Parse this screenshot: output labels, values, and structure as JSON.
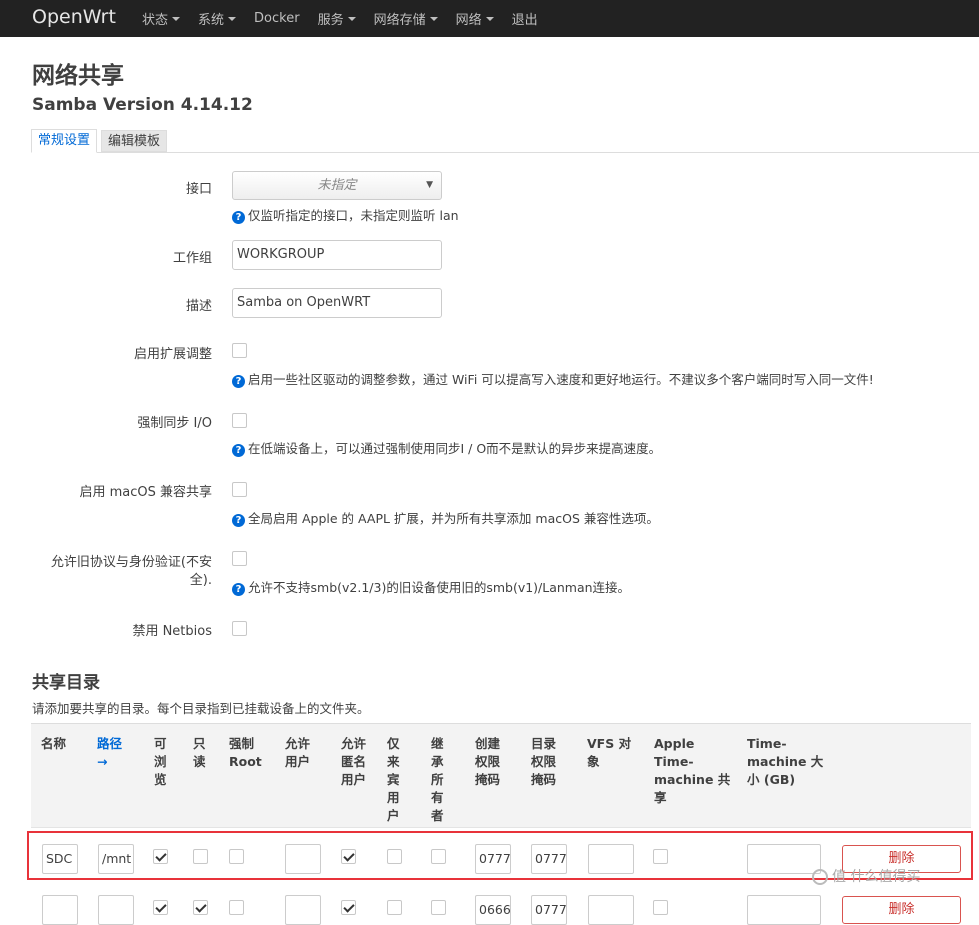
{
  "brand": "OpenWrt",
  "nav": [
    "状态",
    "系统",
    "Docker",
    "服务",
    "网络存储",
    "网络",
    "退出"
  ],
  "page_title": "网络共享",
  "version": "Samba Version 4.14.12",
  "tabs": [
    "常规设置",
    "编辑模板"
  ],
  "fields": {
    "interface_label": "接口",
    "interface_value": "未指定",
    "interface_help": "仅监听指定的接口，未指定则监听 lan",
    "workgroup_label": "工作组",
    "workgroup_value": "WORKGROUP",
    "description_label": "描述",
    "description_value": "Samba on OpenWRT",
    "ext_tuning_label": "启用扩展调整",
    "ext_tuning_help": "启用一些社区驱动的调整参数，通过 WiFi 可以提高写入速度和更好地运行。不建议多个客户端同时写入同一文件!",
    "sync_io_label": "强制同步 I/O",
    "sync_io_help": "在低端设备上，可以通过强制使用同步I / O而不是默认的异步来提高速度。",
    "macos_label": "启用 macOS 兼容共享",
    "macos_help": "全局启用 Apple 的 AAPL 扩展，并为所有共享添加 macOS 兼容性选项。",
    "legacy_label_1": "允许旧协议与身份验证(不安",
    "legacy_label_2": "全).",
    "legacy_help": "允许不支持smb(v2.1/3)的旧设备使用旧的smb(v1)/Lanman连接。",
    "netbios_label": "禁用 Netbios"
  },
  "shares": {
    "title": "共享目录",
    "description": "请添加要共享的目录。每个目录指到已挂载设备上的文件夹。",
    "headers": {
      "name": "名称",
      "path_1": "路径",
      "path_2": "→",
      "browse": [
        "可",
        "浏",
        "览"
      ],
      "readonly": [
        "只",
        "读"
      ],
      "force_root": [
        "强制",
        "Root"
      ],
      "users": [
        "允许",
        "用户"
      ],
      "guest": [
        "允许",
        "匿名",
        "用户"
      ],
      "guest_only": [
        "仅",
        "来",
        "宾",
        "用",
        "户"
      ],
      "inherit_owner": [
        "继",
        "承",
        "所",
        "有",
        "者"
      ],
      "create_mask": [
        "创建",
        "权限",
        "掩码"
      ],
      "dir_mask": [
        "目录",
        "权限",
        "掩码"
      ],
      "vfs": [
        "VFS 对",
        "象"
      ],
      "timemachine": [
        "Apple",
        "Time-",
        "machine 共",
        "享"
      ],
      "tm_size": [
        "Time-",
        "machine 大",
        "小 (GB)"
      ]
    },
    "rows": [
      {
        "name": "SDC",
        "path": "/mnt",
        "create_mask": "0777",
        "dir_mask": "0777",
        "delete": "删除"
      },
      {
        "name": "",
        "path": "",
        "create_mask": "0666",
        "dir_mask": "0777",
        "delete": "删除"
      }
    ]
  },
  "watermark": "值 什么值得买"
}
